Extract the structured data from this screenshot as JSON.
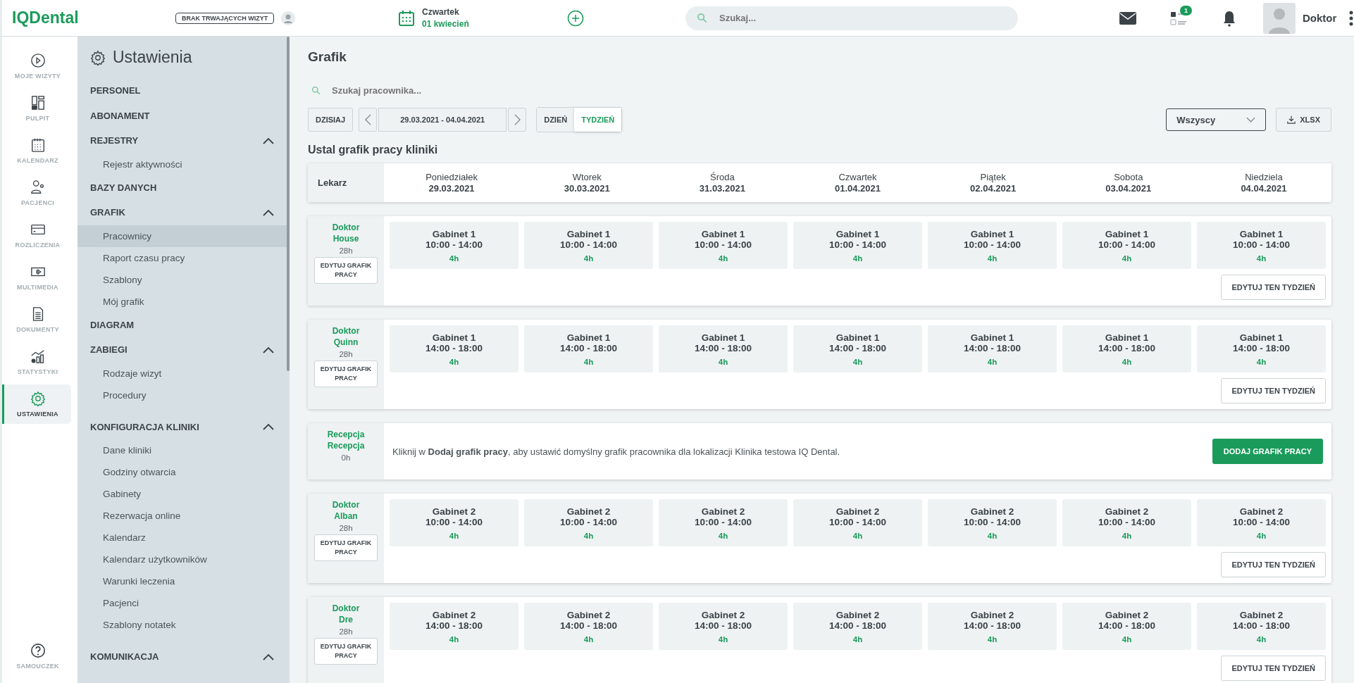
{
  "topbar": {
    "logo": "IQDental",
    "visit_status": "BRAK TRWAJĄCYCH WIZYT",
    "date": {
      "day": "Czwartek",
      "date": "01 kwiecień"
    },
    "search": {
      "placeholder": "Szukaj..."
    },
    "tasks_badge": "1",
    "user": "Doktor"
  },
  "rail": {
    "items": [
      {
        "label": "MOJE WIZYTY",
        "selected": false
      },
      {
        "label": "PULPIT",
        "selected": false
      },
      {
        "label": "KALENDARZ",
        "selected": false
      },
      {
        "label": "PACJENCI",
        "selected": false
      },
      {
        "label": "ROZLICZENIA",
        "selected": false
      },
      {
        "label": "MULTIMEDIA",
        "selected": false
      },
      {
        "label": "DOKUMENTY",
        "selected": false
      },
      {
        "label": "STATYSTYKI",
        "selected": false
      },
      {
        "label": "USTAWIENIA",
        "selected": true
      }
    ],
    "help": "SAMOUCZEK"
  },
  "sidebar": {
    "title": "Ustawienia",
    "sections": [
      {
        "label": "PERSONEL",
        "kind": "link"
      },
      {
        "label": "ABONAMENT",
        "kind": "link"
      },
      {
        "label": "REJESTRY",
        "kind": "group",
        "expanded": true,
        "children": [
          {
            "label": "Rejestr aktywności",
            "selected": false
          }
        ]
      },
      {
        "label": "BAZY DANYCH",
        "kind": "link"
      },
      {
        "label": "GRAFIK",
        "kind": "group",
        "expanded": true,
        "children": [
          {
            "label": "Pracownicy",
            "selected": true
          },
          {
            "label": "Raport czasu pracy",
            "selected": false
          },
          {
            "label": "Szablony",
            "selected": false
          },
          {
            "label": "Mój grafik",
            "selected": false
          }
        ]
      },
      {
        "label": "DIAGRAM",
        "kind": "link"
      },
      {
        "label": "ZABIEGI",
        "kind": "group",
        "expanded": true,
        "children": [
          {
            "label": "Rodzaje wizyt",
            "selected": false
          },
          {
            "label": "Procedury",
            "selected": false
          }
        ]
      },
      {
        "label": "KONFIGURACJA KLINIKI",
        "kind": "group",
        "expanded": true,
        "children": [
          {
            "label": "Dane kliniki",
            "selected": false
          },
          {
            "label": "Godziny otwarcia",
            "selected": false
          },
          {
            "label": "Gabinety",
            "selected": false
          },
          {
            "label": "Rezerwacja online",
            "selected": false
          },
          {
            "label": "Kalendarz",
            "selected": false
          },
          {
            "label": "Kalendarz użytkowników",
            "selected": false
          },
          {
            "label": "Warunki leczenia",
            "selected": false
          },
          {
            "label": "Pacjenci",
            "selected": false
          },
          {
            "label": "Szablony notatek",
            "selected": false
          }
        ]
      },
      {
        "label": "KOMUNIKACJA",
        "kind": "group",
        "expanded": true
      }
    ]
  },
  "main": {
    "title": "Grafik",
    "search": {
      "placeholder": "Szukaj pracownika..."
    },
    "today_button": "DZISIAJ",
    "range": "29.03.2021 - 04.04.2021",
    "views": [
      {
        "label": "DZIEŃ",
        "selected": false
      },
      {
        "label": "TYDZIEŃ",
        "selected": true
      }
    ],
    "filter": "Wszyscy",
    "export_button": "XLSX",
    "heading": "Ustal grafik pracy kliniki",
    "header": {
      "label": "Lekarz",
      "days": [
        {
          "name": "Poniedziałek",
          "date": "29.03.2021"
        },
        {
          "name": "Wtorek",
          "date": "30.03.2021"
        },
        {
          "name": "Środa",
          "date": "31.03.2021"
        },
        {
          "name": "Czwartek",
          "date": "01.04.2021"
        },
        {
          "name": "Piątek",
          "date": "02.04.2021"
        },
        {
          "name": "Sobota",
          "date": "03.04.2021"
        },
        {
          "name": "Niedziela",
          "date": "04.04.2021"
        }
      ]
    },
    "staff": [
      {
        "kind": "schedule",
        "first": "Doktor",
        "last": "House",
        "hours": "28h",
        "edit_button": "EDYTUJ GRAFIK PRACY",
        "week_button": "EDYTUJ TEN TYDZIEŃ",
        "shifts": [
          {
            "room": "Gabinet 1",
            "time": "10:00 - 14:00",
            "hours": "4h"
          },
          {
            "room": "Gabinet 1",
            "time": "10:00 - 14:00",
            "hours": "4h"
          },
          {
            "room": "Gabinet 1",
            "time": "10:00 - 14:00",
            "hours": "4h"
          },
          {
            "room": "Gabinet 1",
            "time": "10:00 - 14:00",
            "hours": "4h"
          },
          {
            "room": "Gabinet 1",
            "time": "10:00 - 14:00",
            "hours": "4h"
          },
          {
            "room": "Gabinet 1",
            "time": "10:00 - 14:00",
            "hours": "4h"
          },
          {
            "room": "Gabinet 1",
            "time": "10:00 - 14:00",
            "hours": "4h"
          }
        ]
      },
      {
        "kind": "schedule",
        "first": "Doktor",
        "last": "Quinn",
        "hours": "28h",
        "edit_button": "EDYTUJ GRAFIK PRACY",
        "week_button": "EDYTUJ TEN TYDZIEŃ",
        "shifts": [
          {
            "room": "Gabinet 1",
            "time": "14:00 - 18:00",
            "hours": "4h"
          },
          {
            "room": "Gabinet 1",
            "time": "14:00 - 18:00",
            "hours": "4h"
          },
          {
            "room": "Gabinet 1",
            "time": "14:00 - 18:00",
            "hours": "4h"
          },
          {
            "room": "Gabinet 1",
            "time": "14:00 - 18:00",
            "hours": "4h"
          },
          {
            "room": "Gabinet 1",
            "time": "14:00 - 18:00",
            "hours": "4h"
          },
          {
            "room": "Gabinet 1",
            "time": "14:00 - 18:00",
            "hours": "4h"
          },
          {
            "room": "Gabinet 1",
            "time": "14:00 - 18:00",
            "hours": "4h"
          }
        ]
      },
      {
        "kind": "empty",
        "first": "Recepcja",
        "last": "Recepcja",
        "hours": "0h",
        "message": "Kliknij w **Dodaj grafik pracy**, aby ustawić domyślny grafik pracownika dla lokalizacji Klinika testowa IQ Dental.",
        "add_button": "DODAJ GRAFIK PRACY"
      },
      {
        "kind": "schedule",
        "first": "Doktor",
        "last": "Alban",
        "hours": "28h",
        "edit_button": "EDYTUJ GRAFIK PRACY",
        "week_button": "EDYTUJ TEN TYDZIEŃ",
        "shifts": [
          {
            "room": "Gabinet 2",
            "time": "10:00 - 14:00",
            "hours": "4h"
          },
          {
            "room": "Gabinet 2",
            "time": "10:00 - 14:00",
            "hours": "4h"
          },
          {
            "room": "Gabinet 2",
            "time": "10:00 - 14:00",
            "hours": "4h"
          },
          {
            "room": "Gabinet 2",
            "time": "10:00 - 14:00",
            "hours": "4h"
          },
          {
            "room": "Gabinet 2",
            "time": "10:00 - 14:00",
            "hours": "4h"
          },
          {
            "room": "Gabinet 2",
            "time": "10:00 - 14:00",
            "hours": "4h"
          },
          {
            "room": "Gabinet 2",
            "time": "10:00 - 14:00",
            "hours": "4h"
          }
        ]
      },
      {
        "kind": "schedule",
        "first": "Doktor",
        "last": "Dre",
        "hours": "28h",
        "edit_button": "EDYTUJ GRAFIK PRACY",
        "week_button": "EDYTUJ TEN TYDZIEŃ",
        "shifts": [
          {
            "room": "Gabinet 2",
            "time": "14:00 - 18:00",
            "hours": "4h"
          },
          {
            "room": "Gabinet 2",
            "time": "14:00 - 18:00",
            "hours": "4h"
          },
          {
            "room": "Gabinet 2",
            "time": "14:00 - 18:00",
            "hours": "4h"
          },
          {
            "room": "Gabinet 2",
            "time": "14:00 - 18:00",
            "hours": "4h"
          },
          {
            "room": "Gabinet 2",
            "time": "14:00 - 18:00",
            "hours": "4h"
          },
          {
            "room": "Gabinet 2",
            "time": "14:00 - 18:00",
            "hours": "4h"
          },
          {
            "room": "Gabinet 2",
            "time": "14:00 - 18:00",
            "hours": "4h"
          }
        ]
      }
    ]
  }
}
